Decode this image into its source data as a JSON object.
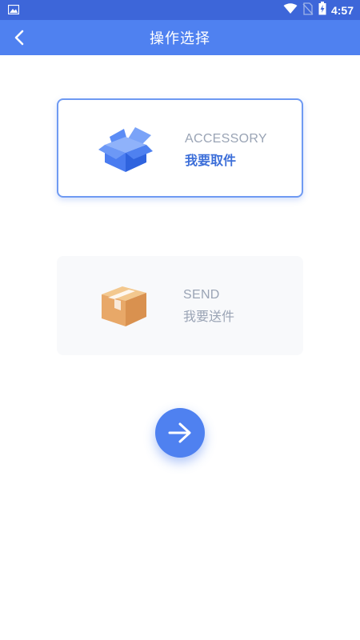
{
  "status_bar": {
    "time": "4:57",
    "icons": [
      "image-icon",
      "wifi-icon",
      "no-sim-icon",
      "battery-charging-icon"
    ]
  },
  "app_bar": {
    "title": "操作选择",
    "back_icon": "chevron-left-icon"
  },
  "options": [
    {
      "id": "accessory",
      "label_en": "ACCESSORY",
      "label_cn": "我要取件",
      "icon": "open-box-icon",
      "selected": true,
      "color": "#3d6fd9"
    },
    {
      "id": "send",
      "label_en": "SEND",
      "label_cn": "我要送件",
      "icon": "parcel-box-icon",
      "selected": false,
      "color": "#9aa4b5"
    }
  ],
  "next_button": {
    "icon": "arrow-right-icon",
    "color": "#4f81f0"
  },
  "colors": {
    "status_bar": "#3d66d9",
    "app_bar": "#4f81f0",
    "accent": "#4f81f0"
  }
}
